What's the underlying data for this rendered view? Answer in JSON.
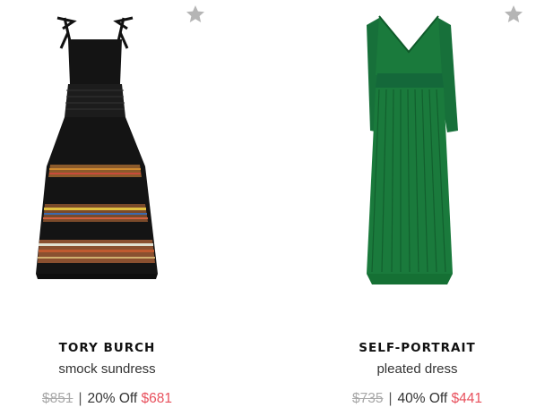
{
  "products": [
    {
      "brand": "TORY BURCH",
      "name": "smock sundress",
      "old_price": "$851",
      "separator": "|",
      "discount": "20% Off",
      "sale_price": "$681",
      "image_icon": "black-striped-sundress-image",
      "favorite_icon": "star-icon"
    },
    {
      "brand": "SELF-PORTRAIT",
      "name": "pleated dress",
      "old_price": "$735",
      "separator": "|",
      "discount": "40% Off",
      "sale_price": "$441",
      "image_icon": "green-pleated-dress-image",
      "favorite_icon": "star-icon"
    }
  ],
  "colors": {
    "sale": "#e8515d",
    "old_price": "#a8a8a8",
    "star": "#b5b5b5",
    "dress_green": "#1a7a3c",
    "dress_black": "#141414"
  }
}
